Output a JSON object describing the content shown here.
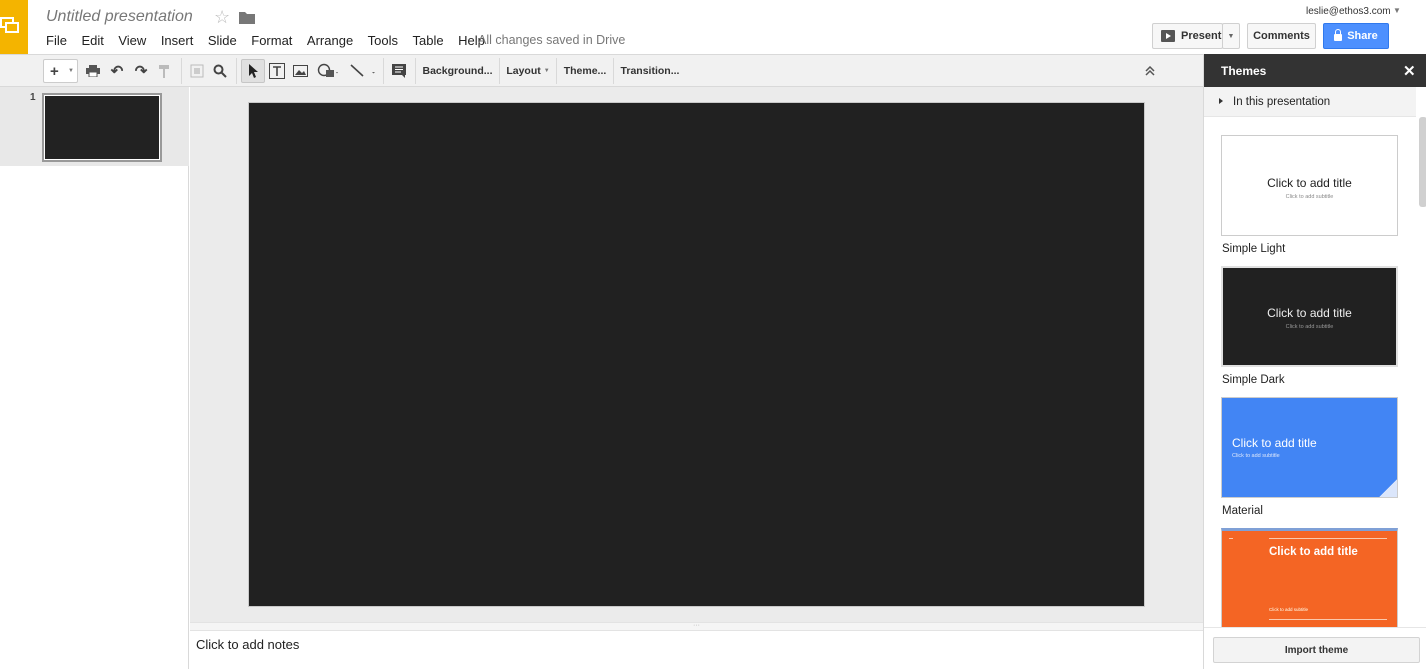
{
  "app": {
    "title": "Untitled presentation",
    "save_status": "All changes saved in Drive",
    "account": "leslie@ethos3.com"
  },
  "menu": [
    "File",
    "Edit",
    "View",
    "Insert",
    "Slide",
    "Format",
    "Arrange",
    "Tools",
    "Table",
    "Help"
  ],
  "header_buttons": {
    "present": "Present",
    "comments": "Comments",
    "share": "Share"
  },
  "toolbar": {
    "new_slide": "+",
    "background": "Background...",
    "layout": "Layout",
    "theme": "Theme...",
    "transition": "Transition..."
  },
  "filmstrip": {
    "slides": [
      {
        "number": "1"
      }
    ]
  },
  "notes": {
    "placeholder": "Click to add notes"
  },
  "themes_panel": {
    "title": "Themes",
    "section": "In this presentation",
    "import_button": "Import theme",
    "themes": [
      {
        "name": "Simple Light",
        "preview_title": "Click to add title",
        "preview_subtitle": "Click to add subtitle"
      },
      {
        "name": "Simple Dark",
        "preview_title": "Click to add title",
        "preview_subtitle": "Click to add subtitle"
      },
      {
        "name": "Material",
        "preview_title": "Click to add title",
        "preview_subtitle": "Click to add subtitle"
      },
      {
        "name": "",
        "preview_title": "Click to add title",
        "preview_subtitle": "Click to add subtitle"
      }
    ]
  },
  "colors": {
    "brand_yellow": "#f4b400",
    "share_blue": "#4d90fe",
    "slide_dark": "#212121",
    "material_blue": "#4285f4",
    "orange_theme": "#f46524"
  }
}
